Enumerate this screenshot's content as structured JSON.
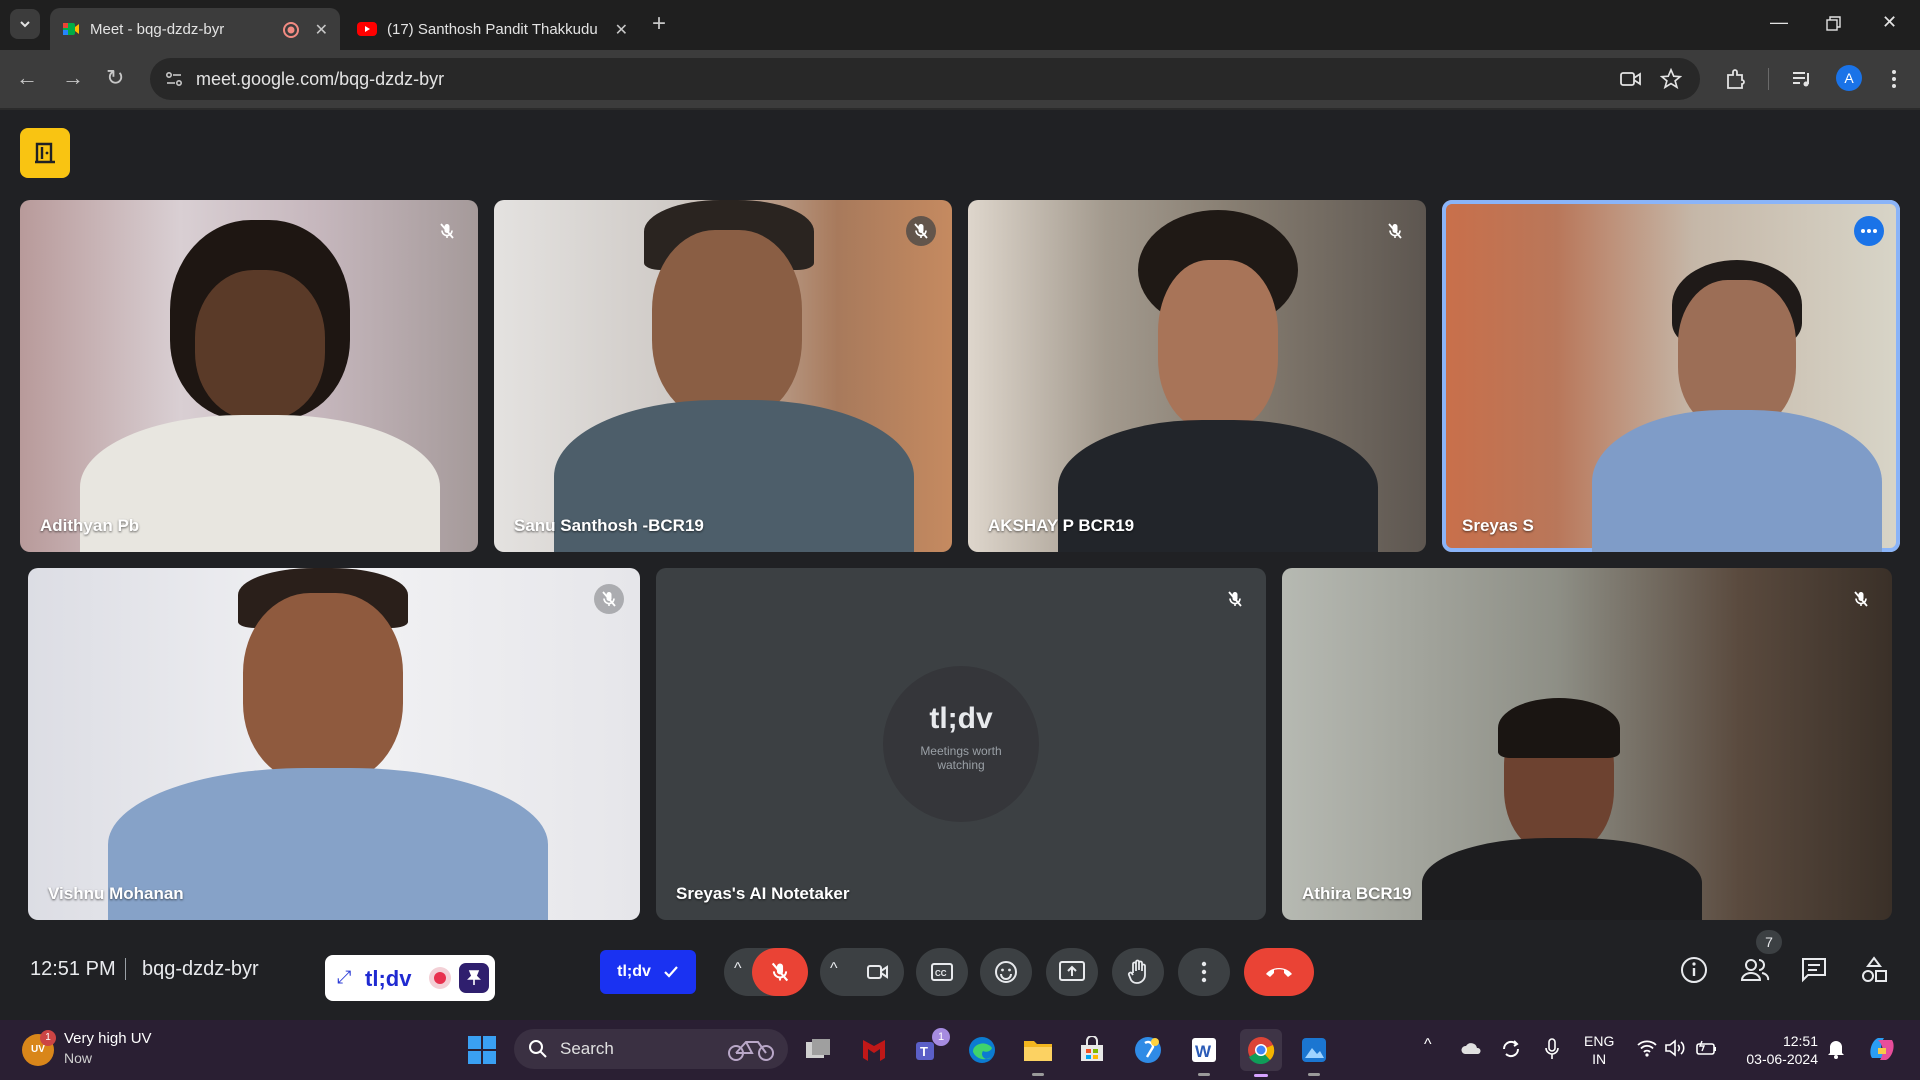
{
  "browser": {
    "tabs": [
      {
        "title": "Meet - bqg-dzdz-byr",
        "active": true,
        "recording": true
      },
      {
        "title": "(17) Santhosh Pandit Thakkudu",
        "active": false
      }
    ],
    "url": "meet.google.com/bqg-dzdz-byr",
    "profile_initial": "A"
  },
  "meeting": {
    "time": "12:51 PM",
    "code": "bqg-dzdz-byr",
    "participant_count": "7",
    "participants": [
      {
        "name": "Adithyan Pb",
        "muted": true
      },
      {
        "name": "Sanu Santhosh -BCR19",
        "muted": true
      },
      {
        "name": "AKSHAY P BCR19",
        "muted": true
      },
      {
        "name": "Sreyas S",
        "muted": false,
        "speaking": true
      },
      {
        "name": "Vishnu Mohanan",
        "muted": true
      },
      {
        "name": "Sreyas's AI Notetaker",
        "muted": true
      },
      {
        "name": "Athira BCR19",
        "muted": true
      }
    ],
    "notetaker_logo": "tl;dv",
    "notetaker_tagline": "Meetings worth watching"
  },
  "tldv": {
    "widget_brand": "tl;dv",
    "pill_label": "tl;dv"
  },
  "colors": {
    "accent": "#8ab4f8",
    "end_call": "#ea4335",
    "ext_badge": "#f9c412",
    "tldv_blue": "#1a32f2"
  },
  "taskbar": {
    "weather_title": "Very high UV",
    "weather_sub": "Now",
    "weather_badge": "1",
    "weather_icon_text": "UV",
    "search_placeholder": "Search",
    "teams_badge": "1",
    "lang_line1": "ENG",
    "lang_line2": "IN",
    "clock_time": "12:51",
    "clock_date": "03-06-2024"
  }
}
